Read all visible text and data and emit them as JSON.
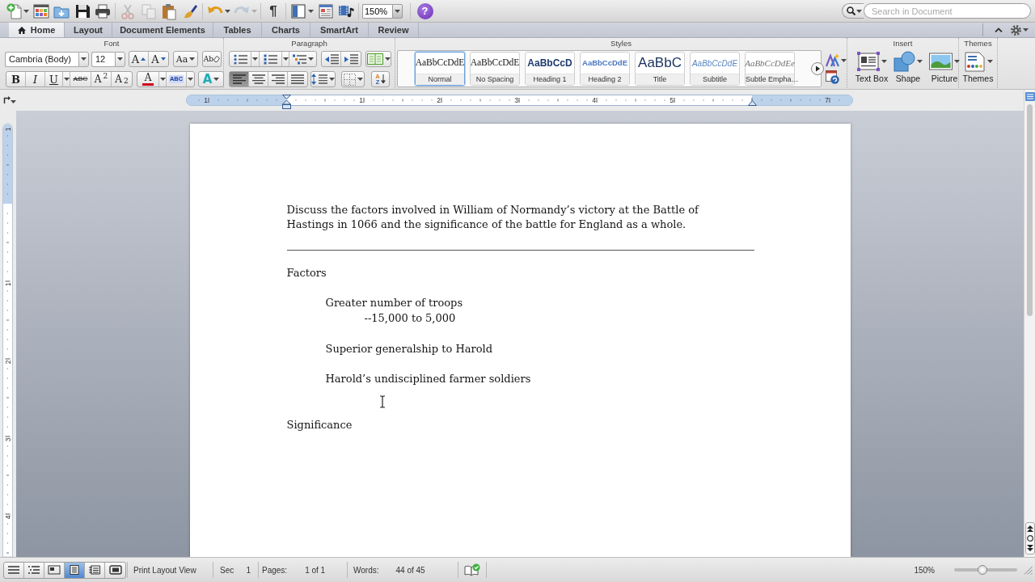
{
  "toolbar": {
    "groups": [
      [
        {
          "kind": "new",
          "disabled": false
        },
        {
          "kind": "gallery",
          "disabled": false
        },
        {
          "kind": "open",
          "disabled": false
        },
        {
          "kind": "save",
          "disabled": false
        },
        {
          "kind": "print",
          "disabled": false
        }
      ],
      [
        {
          "kind": "cut",
          "disabled": true
        },
        {
          "kind": "copy",
          "disabled": true
        },
        {
          "kind": "paste",
          "disabled": false
        },
        {
          "kind": "brush",
          "disabled": false
        }
      ],
      [
        {
          "kind": "undo",
          "disabled": false
        },
        {
          "kind": "redo",
          "disabled": true
        }
      ],
      [
        {
          "kind": "pilcrow",
          "label": "¶",
          "disabled": false
        }
      ],
      [
        {
          "kind": "sidebar",
          "disabled": false
        },
        {
          "kind": "layout",
          "disabled": false
        },
        {
          "kind": "media",
          "disabled": false
        }
      ],
      [
        {
          "kind": "zoom",
          "value": "150%",
          "disabled": false
        }
      ],
      [
        {
          "kind": "help",
          "label": "?",
          "disabled": false
        }
      ]
    ],
    "search": {
      "placeholder": "Search in Document"
    }
  },
  "tabs": [
    {
      "label": "Home",
      "selected": true
    },
    {
      "label": "Layout",
      "selected": false
    },
    {
      "label": "Document Elements",
      "selected": false
    },
    {
      "label": "Tables",
      "selected": false
    },
    {
      "label": "Charts",
      "selected": false
    },
    {
      "label": "SmartArt",
      "selected": false
    },
    {
      "label": "Review",
      "selected": false
    }
  ],
  "ribbon": {
    "font": {
      "title": "Font",
      "font_name": "Cambria (Body)",
      "font_size": "12",
      "grow": "A",
      "shrink": "A",
      "change_case": "Aa",
      "clear_formatting": "Ab",
      "formats": [
        {
          "kind": "bold",
          "label": "B"
        },
        {
          "kind": "italic",
          "label": "I"
        },
        {
          "kind": "underline",
          "label": "U"
        },
        {
          "kind": "strike",
          "label": "ABC"
        },
        {
          "kind": "superscript",
          "label": "A$^{2}$"
        },
        {
          "kind": "subscript",
          "label": "A$_{2}$"
        }
      ],
      "font_color": "A",
      "highlight": "ABC",
      "text_effects": "A"
    },
    "paragraph": {
      "title": "Paragraph",
      "alignments": [
        {
          "kind": "left",
          "selected": true
        },
        {
          "kind": "center",
          "selected": false
        },
        {
          "kind": "right",
          "selected": false
        },
        {
          "kind": "justify",
          "selected": false
        }
      ],
      "sort": [
        "A",
        "Z"
      ]
    },
    "styles": {
      "title": "Styles",
      "items": [
        {
          "kind": "normal",
          "preview": "AaBbCcDdE",
          "name": "Normal",
          "selected": true
        },
        {
          "kind": "no_spacing",
          "preview": "AaBbCcDdE",
          "name": "No Spacing",
          "selected": false
        },
        {
          "kind": "heading1",
          "preview": "AaBbCcD",
          "name": "Heading 1",
          "selected": false
        },
        {
          "kind": "heading2",
          "preview": "AaBbCcDdE",
          "name": "Heading 2",
          "selected": false
        },
        {
          "kind": "title",
          "preview": "AaBbC",
          "name": "Title",
          "selected": false
        },
        {
          "kind": "subtitle",
          "preview": "AaBbCcDdE",
          "name": "Subtitle",
          "selected": false
        },
        {
          "kind": "emphasis",
          "preview": "AaBbCcDdEe",
          "name": "Subtle Empha…",
          "selected": false
        }
      ]
    },
    "insert": {
      "title": "Insert",
      "items": [
        {
          "kind": "textbox",
          "label": "Text Box"
        },
        {
          "kind": "shape",
          "label": "Shape"
        },
        {
          "kind": "picture",
          "label": "Picture"
        }
      ]
    },
    "themes": {
      "title": "Themes",
      "label": "Themes"
    }
  },
  "ruler": {
    "labels": [
      "1",
      "1",
      "2",
      "3",
      "4",
      "5",
      "7"
    ]
  },
  "vertical_ruler": {
    "labels": [
      "1",
      "1",
      "2",
      "3",
      "4"
    ]
  },
  "document": {
    "question": "Discuss the factors involved in William of Normandy’s victory at the Battle of Hastings in 1066 and the significance of the battle for England as a whole.",
    "sections": [
      {
        "heading": "Factors",
        "points": [
          {
            "text": "Greater number of troops",
            "children": [
              {
                "text": "--15,000 to 5,000"
              }
            ]
          },
          {
            "text": "Superior generalship to Harold"
          },
          {
            "text": "Harold’s undisciplined farmer soldiers"
          }
        ]
      },
      {
        "heading": "Significance"
      }
    ]
  },
  "status_bar": {
    "views": [
      {
        "kind": "draft",
        "selected": false
      },
      {
        "kind": "outline",
        "selected": false
      },
      {
        "kind": "publishing",
        "selected": false
      },
      {
        "kind": "print",
        "selected": true
      },
      {
        "kind": "notebook",
        "selected": false
      },
      {
        "kind": "fullscreen",
        "selected": false
      }
    ],
    "view_name": "Print Layout View",
    "section_label": "Sec",
    "section": "1",
    "pages_label": "Pages:",
    "pages": "1 of 1",
    "words_label": "Words:",
    "words": "44 of 45",
    "zoom": "150%",
    "zoom_slider": {
      "level": 0.45
    }
  }
}
